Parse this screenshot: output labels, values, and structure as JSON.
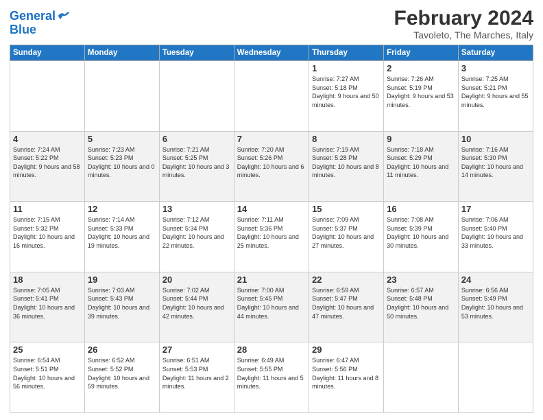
{
  "header": {
    "logo_line1": "General",
    "logo_line2": "Blue",
    "title": "February 2024",
    "subtitle": "Tavoleto, The Marches, Italy"
  },
  "weekdays": [
    "Sunday",
    "Monday",
    "Tuesday",
    "Wednesday",
    "Thursday",
    "Friday",
    "Saturday"
  ],
  "weeks": [
    [
      {
        "day": "",
        "sunrise": "",
        "sunset": "",
        "daylight": ""
      },
      {
        "day": "",
        "sunrise": "",
        "sunset": "",
        "daylight": ""
      },
      {
        "day": "",
        "sunrise": "",
        "sunset": "",
        "daylight": ""
      },
      {
        "day": "",
        "sunrise": "",
        "sunset": "",
        "daylight": ""
      },
      {
        "day": "1",
        "sunrise": "Sunrise: 7:27 AM",
        "sunset": "Sunset: 5:18 PM",
        "daylight": "Daylight: 9 hours and 50 minutes."
      },
      {
        "day": "2",
        "sunrise": "Sunrise: 7:26 AM",
        "sunset": "Sunset: 5:19 PM",
        "daylight": "Daylight: 9 hours and 53 minutes."
      },
      {
        "day": "3",
        "sunrise": "Sunrise: 7:25 AM",
        "sunset": "Sunset: 5:21 PM",
        "daylight": "Daylight: 9 hours and 55 minutes."
      }
    ],
    [
      {
        "day": "4",
        "sunrise": "Sunrise: 7:24 AM",
        "sunset": "Sunset: 5:22 PM",
        "daylight": "Daylight: 9 hours and 58 minutes."
      },
      {
        "day": "5",
        "sunrise": "Sunrise: 7:23 AM",
        "sunset": "Sunset: 5:23 PM",
        "daylight": "Daylight: 10 hours and 0 minutes."
      },
      {
        "day": "6",
        "sunrise": "Sunrise: 7:21 AM",
        "sunset": "Sunset: 5:25 PM",
        "daylight": "Daylight: 10 hours and 3 minutes."
      },
      {
        "day": "7",
        "sunrise": "Sunrise: 7:20 AM",
        "sunset": "Sunset: 5:26 PM",
        "daylight": "Daylight: 10 hours and 6 minutes."
      },
      {
        "day": "8",
        "sunrise": "Sunrise: 7:19 AM",
        "sunset": "Sunset: 5:28 PM",
        "daylight": "Daylight: 10 hours and 8 minutes."
      },
      {
        "day": "9",
        "sunrise": "Sunrise: 7:18 AM",
        "sunset": "Sunset: 5:29 PM",
        "daylight": "Daylight: 10 hours and 11 minutes."
      },
      {
        "day": "10",
        "sunrise": "Sunrise: 7:16 AM",
        "sunset": "Sunset: 5:30 PM",
        "daylight": "Daylight: 10 hours and 14 minutes."
      }
    ],
    [
      {
        "day": "11",
        "sunrise": "Sunrise: 7:15 AM",
        "sunset": "Sunset: 5:32 PM",
        "daylight": "Daylight: 10 hours and 16 minutes."
      },
      {
        "day": "12",
        "sunrise": "Sunrise: 7:14 AM",
        "sunset": "Sunset: 5:33 PM",
        "daylight": "Daylight: 10 hours and 19 minutes."
      },
      {
        "day": "13",
        "sunrise": "Sunrise: 7:12 AM",
        "sunset": "Sunset: 5:34 PM",
        "daylight": "Daylight: 10 hours and 22 minutes."
      },
      {
        "day": "14",
        "sunrise": "Sunrise: 7:11 AM",
        "sunset": "Sunset: 5:36 PM",
        "daylight": "Daylight: 10 hours and 25 minutes."
      },
      {
        "day": "15",
        "sunrise": "Sunrise: 7:09 AM",
        "sunset": "Sunset: 5:37 PM",
        "daylight": "Daylight: 10 hours and 27 minutes."
      },
      {
        "day": "16",
        "sunrise": "Sunrise: 7:08 AM",
        "sunset": "Sunset: 5:39 PM",
        "daylight": "Daylight: 10 hours and 30 minutes."
      },
      {
        "day": "17",
        "sunrise": "Sunrise: 7:06 AM",
        "sunset": "Sunset: 5:40 PM",
        "daylight": "Daylight: 10 hours and 33 minutes."
      }
    ],
    [
      {
        "day": "18",
        "sunrise": "Sunrise: 7:05 AM",
        "sunset": "Sunset: 5:41 PM",
        "daylight": "Daylight: 10 hours and 36 minutes."
      },
      {
        "day": "19",
        "sunrise": "Sunrise: 7:03 AM",
        "sunset": "Sunset: 5:43 PM",
        "daylight": "Daylight: 10 hours and 39 minutes."
      },
      {
        "day": "20",
        "sunrise": "Sunrise: 7:02 AM",
        "sunset": "Sunset: 5:44 PM",
        "daylight": "Daylight: 10 hours and 42 minutes."
      },
      {
        "day": "21",
        "sunrise": "Sunrise: 7:00 AM",
        "sunset": "Sunset: 5:45 PM",
        "daylight": "Daylight: 10 hours and 44 minutes."
      },
      {
        "day": "22",
        "sunrise": "Sunrise: 6:59 AM",
        "sunset": "Sunset: 5:47 PM",
        "daylight": "Daylight: 10 hours and 47 minutes."
      },
      {
        "day": "23",
        "sunrise": "Sunrise: 6:57 AM",
        "sunset": "Sunset: 5:48 PM",
        "daylight": "Daylight: 10 hours and 50 minutes."
      },
      {
        "day": "24",
        "sunrise": "Sunrise: 6:56 AM",
        "sunset": "Sunset: 5:49 PM",
        "daylight": "Daylight: 10 hours and 53 minutes."
      }
    ],
    [
      {
        "day": "25",
        "sunrise": "Sunrise: 6:54 AM",
        "sunset": "Sunset: 5:51 PM",
        "daylight": "Daylight: 10 hours and 56 minutes."
      },
      {
        "day": "26",
        "sunrise": "Sunrise: 6:52 AM",
        "sunset": "Sunset: 5:52 PM",
        "daylight": "Daylight: 10 hours and 59 minutes."
      },
      {
        "day": "27",
        "sunrise": "Sunrise: 6:51 AM",
        "sunset": "Sunset: 5:53 PM",
        "daylight": "Daylight: 11 hours and 2 minutes."
      },
      {
        "day": "28",
        "sunrise": "Sunrise: 6:49 AM",
        "sunset": "Sunset: 5:55 PM",
        "daylight": "Daylight: 11 hours and 5 minutes."
      },
      {
        "day": "29",
        "sunrise": "Sunrise: 6:47 AM",
        "sunset": "Sunset: 5:56 PM",
        "daylight": "Daylight: 11 hours and 8 minutes."
      },
      {
        "day": "",
        "sunrise": "",
        "sunset": "",
        "daylight": ""
      },
      {
        "day": "",
        "sunrise": "",
        "sunset": "",
        "daylight": ""
      }
    ]
  ]
}
